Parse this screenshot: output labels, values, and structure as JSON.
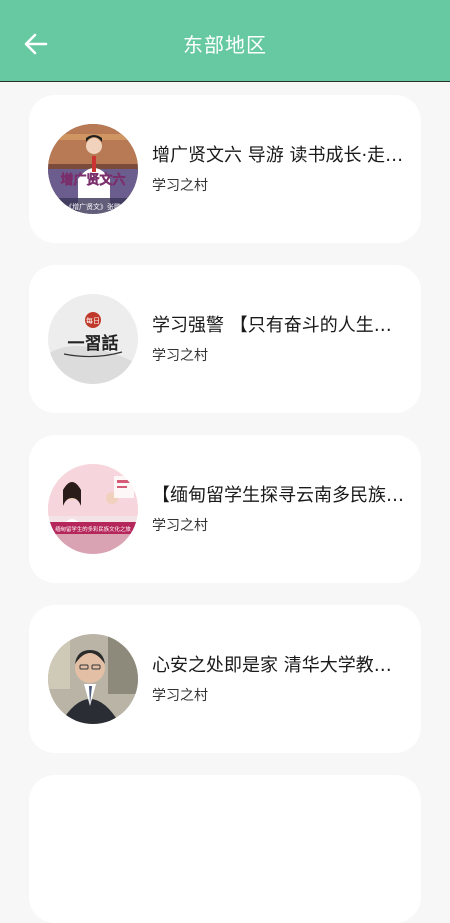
{
  "header": {
    "title": "东部地区",
    "back_icon": "arrow-left-icon",
    "background": "#67c9a1"
  },
  "articles": [
    {
      "title": "增广贤文六 导游 读书成长·走进中国传统文化",
      "source": "学习之村",
      "thumb_text_main": "增广贤文六",
      "thumb_text_sub": "《增广贤文》张鹏"
    },
    {
      "title": "学习强警 【只有奋斗的人生才称得上幸福的人生】",
      "source": "学习之村",
      "thumb_text_small": "每日",
      "thumb_text_main": "一習話"
    },
    {
      "title": "【缅甸留学生探寻云南多民族文化之旅】",
      "source": "学习之村",
      "thumb_text_sub": "缅甸留学生的多彩民族文化之旅"
    },
    {
      "title": "心安之处即是家 清华大学教授讲述人生感悟",
      "source": "学习之村"
    }
  ]
}
